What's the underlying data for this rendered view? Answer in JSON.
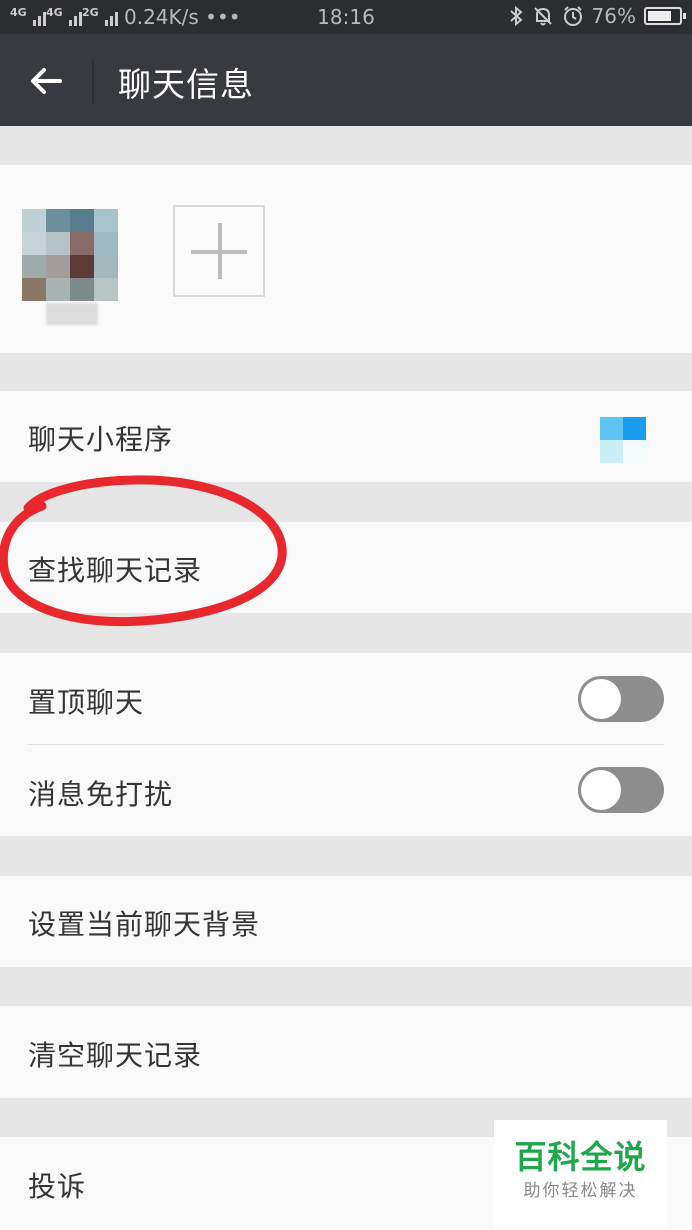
{
  "status_bar": {
    "network_1": "4G",
    "network_2": "4G",
    "network_3": "2G",
    "speed": "0.24K/s •••",
    "time": "18:16",
    "battery": "76%",
    "battery_level": 0.76
  },
  "header": {
    "title": "聊天信息"
  },
  "chat_items": {
    "mini_programs": "聊天小程序",
    "search_history": "查找聊天记录",
    "pin_chat": "置顶聊天",
    "mute_notifications": "消息免打扰",
    "set_background": "设置当前聊天背景",
    "clear_history": "清空聊天记录",
    "report": "投诉"
  },
  "toggles": {
    "pin_chat_on": false,
    "mute_on": false
  },
  "watermark": {
    "title": "百科全说",
    "subtitle": "助你轻松解决"
  },
  "colors": {
    "title_bar": "#393a3f",
    "status_bar": "#2c2d30",
    "annotation_circle": "#e8282d",
    "watermark_green": "#1fa84a"
  }
}
